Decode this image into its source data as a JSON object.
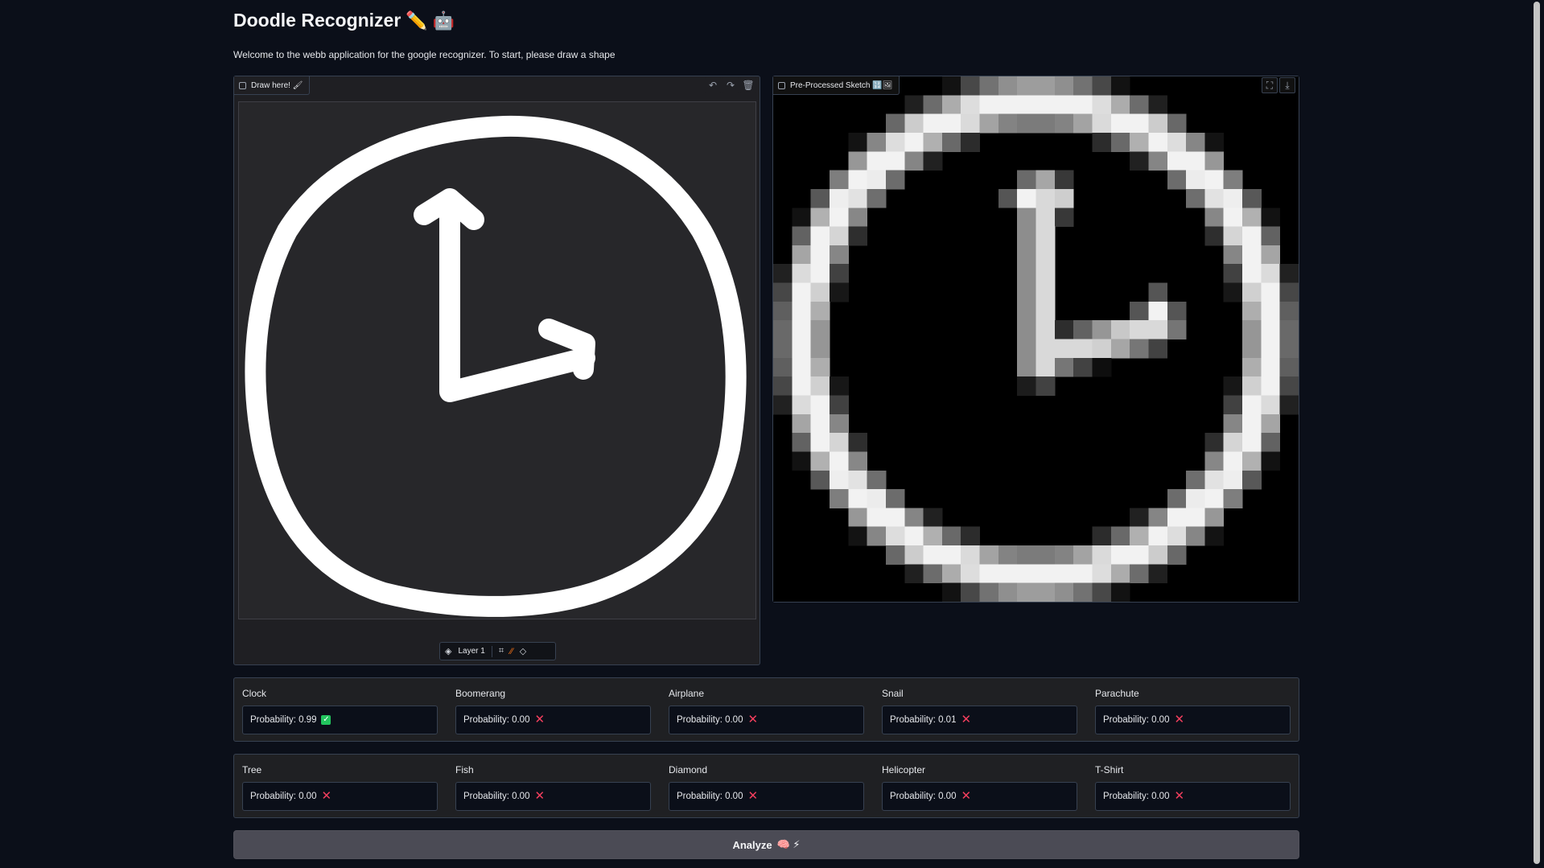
{
  "header": {
    "title": "Doodle Recognizer",
    "title_emoji": "✏️ 🤖",
    "subtitle": "Welcome to the webb application for the google recognizer. To start, please draw a shape"
  },
  "sketchpad": {
    "label": "Draw here! 🖌",
    "tools": [
      "undo-icon",
      "redo-icon",
      "trash-icon"
    ],
    "layer_label": "Layer 1",
    "layer_tools": [
      "crop-icon",
      "brush-icon",
      "eraser-icon"
    ]
  },
  "output_image": {
    "label": "Pre-Processed Sketch 🔢🖼",
    "tools": [
      "fullscreen-icon",
      "download-icon"
    ]
  },
  "results": {
    "row1": [
      {
        "name": "Clock",
        "probability": "Probability: 0.99",
        "status": "check"
      },
      {
        "name": "Boomerang",
        "probability": "Probability: 0.00",
        "status": "cross"
      },
      {
        "name": "Airplane",
        "probability": "Probability: 0.00",
        "status": "cross"
      },
      {
        "name": "Snail",
        "probability": "Probability: 0.01",
        "status": "cross"
      },
      {
        "name": "Parachute",
        "probability": "Probability: 0.00",
        "status": "cross"
      }
    ],
    "row2": [
      {
        "name": "Tree",
        "probability": "Probability: 0.00",
        "status": "cross"
      },
      {
        "name": "Fish",
        "probability": "Probability: 0.00",
        "status": "cross"
      },
      {
        "name": "Diamond",
        "probability": "Probability: 0.00",
        "status": "cross"
      },
      {
        "name": "Helicopter",
        "probability": "Probability: 0.00",
        "status": "cross"
      },
      {
        "name": "T-Shirt",
        "probability": "Probability: 0.00",
        "status": "cross"
      }
    ]
  },
  "analyze_button": {
    "label": "Analyze",
    "emoji": "🧠 ⚡"
  },
  "colors": {
    "background": "#0b0f19",
    "panel": "#1f1f23",
    "check": "#22c55e",
    "cross": "#f43f5e",
    "button": "#4b4b55"
  }
}
